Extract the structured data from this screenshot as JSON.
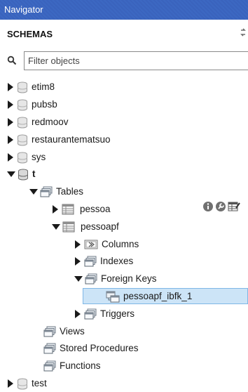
{
  "panel": {
    "title": "Navigator"
  },
  "header": {
    "label": "SCHEMAS",
    "refresh_icon": "refresh-icon"
  },
  "search": {
    "placeholder": "Filter objects",
    "value": ""
  },
  "schemas": [
    {
      "name": "etim8",
      "expanded": false
    },
    {
      "name": "pubsb",
      "expanded": false
    },
    {
      "name": "redmoov",
      "expanded": false
    },
    {
      "name": "restaurantematsuo",
      "expanded": false
    },
    {
      "name": "sys",
      "expanded": false
    },
    {
      "name": "t",
      "expanded": true,
      "bold": true
    },
    {
      "name": "test",
      "expanded": false
    }
  ],
  "tree": {
    "tables_label": "Tables",
    "tables": [
      {
        "name": "pessoa",
        "expanded": false
      },
      {
        "name": "pessoapf",
        "expanded": true
      }
    ],
    "table_children": {
      "columns": "Columns",
      "indexes": "Indexes",
      "foreign_keys": "Foreign Keys",
      "fk_item": "pessoapf_ibfk_1",
      "triggers": "Triggers"
    },
    "views": "Views",
    "stored_procedures": "Stored Procedures",
    "functions": "Functions"
  },
  "colors": {
    "titlebar": "#3a63bd",
    "selection": "#cce4f7",
    "selection_border": "#7fb7e6"
  }
}
